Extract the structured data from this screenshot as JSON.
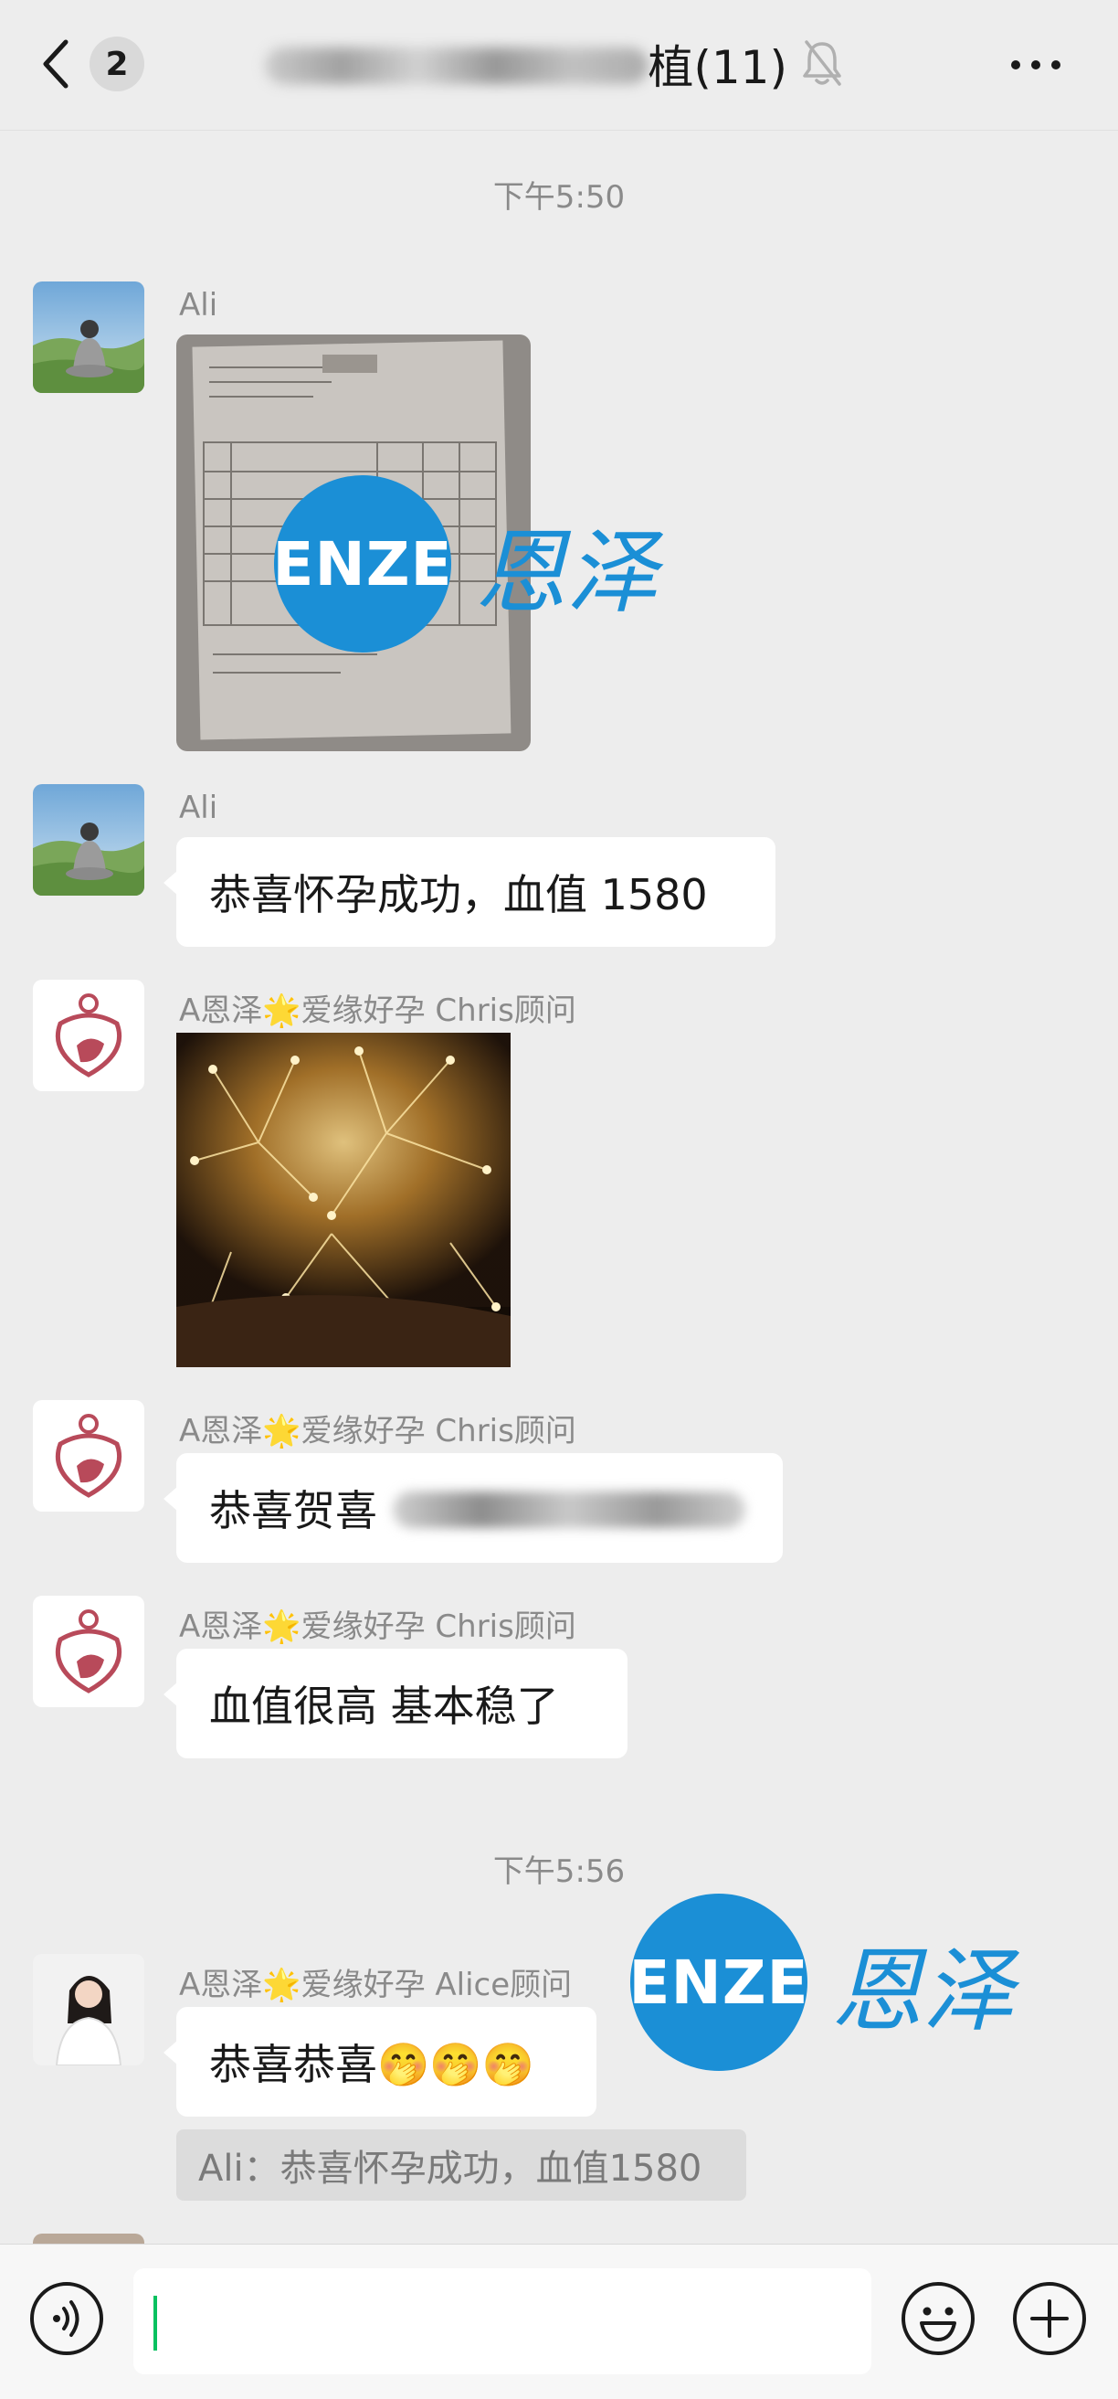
{
  "header": {
    "unread_count": "2",
    "title_visible": "植(11)"
  },
  "times": [
    "下午5:50",
    "下午5:56"
  ],
  "messages": [
    {
      "sender": "Ali",
      "type": "image",
      "image": "document-photo"
    },
    {
      "sender": "Ali",
      "type": "text",
      "text": "恭喜怀孕成功，血值 1580"
    },
    {
      "sender": "A恩泽🌟爱缘好孕 Chris顾问",
      "type": "image",
      "image": "fireworks-photo"
    },
    {
      "sender": "A恩泽🌟爱缘好孕 Chris顾问",
      "type": "text",
      "text": "恭喜贺喜"
    },
    {
      "sender": "A恩泽🌟爱缘好孕 Chris顾问",
      "type": "text",
      "text": "血值很高 基本稳了"
    },
    {
      "sender": "A恩泽🌟爱缘好孕 Alice顾问",
      "type": "text",
      "text": "恭喜恭喜🤭🤭🤭",
      "quote": "Ali：恭喜怀孕成功，血值1580"
    }
  ],
  "watermark": {
    "logo": "ENZE",
    "cn": "恩泽"
  },
  "icons": {
    "back": "chevron-left-icon",
    "mute": "bell-off-icon",
    "more": "more-icon",
    "voice": "voice-icon",
    "emoji": "emoji-icon",
    "plus": "plus-icon"
  },
  "colors": {
    "background": "#ededed",
    "bubble": "#ffffff",
    "watermark": "#1b8fd6",
    "caret": "#07c160"
  }
}
